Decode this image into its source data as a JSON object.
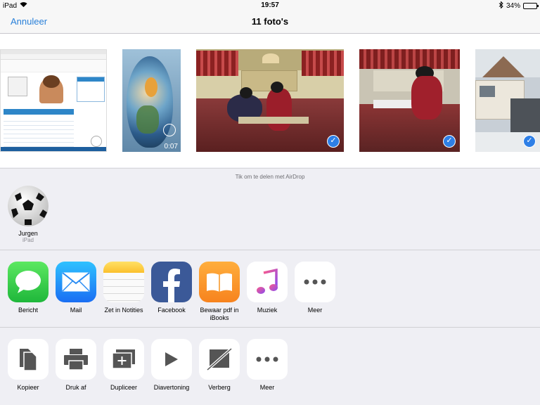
{
  "status": {
    "device": "iPad",
    "time": "19:57",
    "battery": "34%",
    "battery_level": 0.34
  },
  "nav": {
    "cancel": "Annuleer",
    "title": "11 foto's"
  },
  "photos": [
    {
      "kind": "screenshot",
      "selected": false
    },
    {
      "kind": "video",
      "duration": "0:07",
      "selected": false
    },
    {
      "kind": "photo",
      "selected": true
    },
    {
      "kind": "photo",
      "selected": true
    },
    {
      "kind": "photo",
      "selected": true
    }
  ],
  "airdrop": {
    "hint": "Tik om te delen met AirDrop",
    "contacts": [
      {
        "name": "Jurgen",
        "device": "iPad",
        "icon": "soccer-ball-avatar"
      }
    ]
  },
  "share_apps": [
    {
      "label": "Bericht",
      "icon": "messages-icon",
      "color": "#34c759"
    },
    {
      "label": "Mail",
      "icon": "mail-icon",
      "color": "#1e8ff5"
    },
    {
      "label": "Zet in Notities",
      "icon": "notes-icon",
      "color": "#ffd23f"
    },
    {
      "label": "Facebook",
      "icon": "facebook-icon",
      "color": "#3b5998"
    },
    {
      "label": "Bewaar pdf in iBooks",
      "icon": "ibooks-icon",
      "color": "#f7931e"
    },
    {
      "label": "Muziek",
      "icon": "music-icon",
      "color": "#fa2d55"
    },
    {
      "label": "Meer",
      "icon": "more-icon",
      "color": "#ffffff"
    }
  ],
  "actions": [
    {
      "label": "Kopieer",
      "icon": "copy-icon"
    },
    {
      "label": "Druk af",
      "icon": "print-icon"
    },
    {
      "label": "Dupliceer",
      "icon": "duplicate-icon"
    },
    {
      "label": "Diavertoning",
      "icon": "slideshow-icon"
    },
    {
      "label": "Verberg",
      "icon": "hide-icon"
    },
    {
      "label": "Meer",
      "icon": "more-icon"
    }
  ]
}
